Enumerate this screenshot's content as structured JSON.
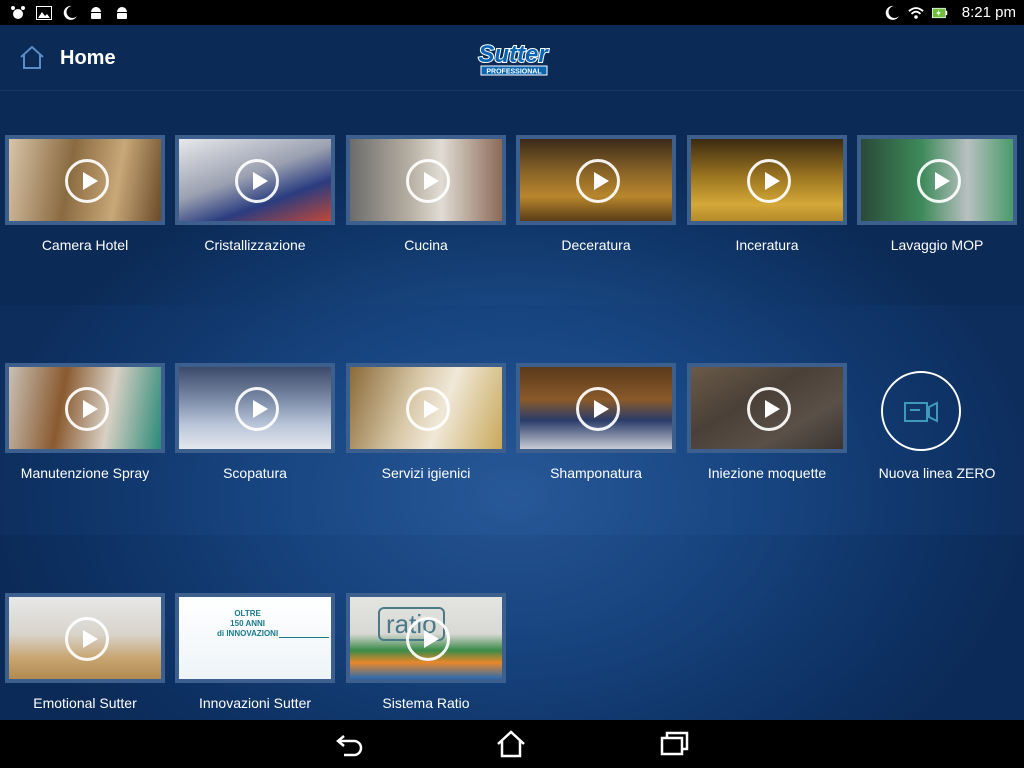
{
  "status_bar": {
    "left_icons": [
      "bug-icon",
      "image-icon",
      "moon-icon",
      "android-icon",
      "android-icon"
    ],
    "right_icons": [
      "moon-icon",
      "wifi-icon",
      "battery-charging-icon"
    ],
    "time": "8:21 pm"
  },
  "header": {
    "title": "Home",
    "logo": {
      "brand": "Sutter",
      "tagline": "PROFESSIONAL"
    }
  },
  "rows": [
    {
      "tiles": [
        {
          "label": "Camera Hotel"
        },
        {
          "label": "Cristallizzazione"
        },
        {
          "label": "Cucina"
        },
        {
          "label": "Deceratura"
        },
        {
          "label": "Inceratura"
        },
        {
          "label": "Lavaggio MOP"
        }
      ]
    },
    {
      "tiles": [
        {
          "label": "Manutenzione Spray"
        },
        {
          "label": "Scopatura"
        },
        {
          "label": "Servizi igienici"
        },
        {
          "label": "Shamponatura"
        },
        {
          "label": "Iniezione moquette"
        }
      ],
      "extra": {
        "label": "Nuova linea ZERO"
      }
    },
    {
      "tiles": [
        {
          "label": "Emotional Sutter"
        },
        {
          "label": "Innovazioni Sutter",
          "overlay": [
            "OLTRE",
            "150 ANNI",
            "di INNOVAZIONI"
          ]
        },
        {
          "label": "Sistema Ratio",
          "overlay": [
            "ratio"
          ]
        }
      ]
    }
  ],
  "navigation_bar": {
    "buttons": [
      "back-icon",
      "home-icon",
      "recent-apps-icon"
    ]
  }
}
